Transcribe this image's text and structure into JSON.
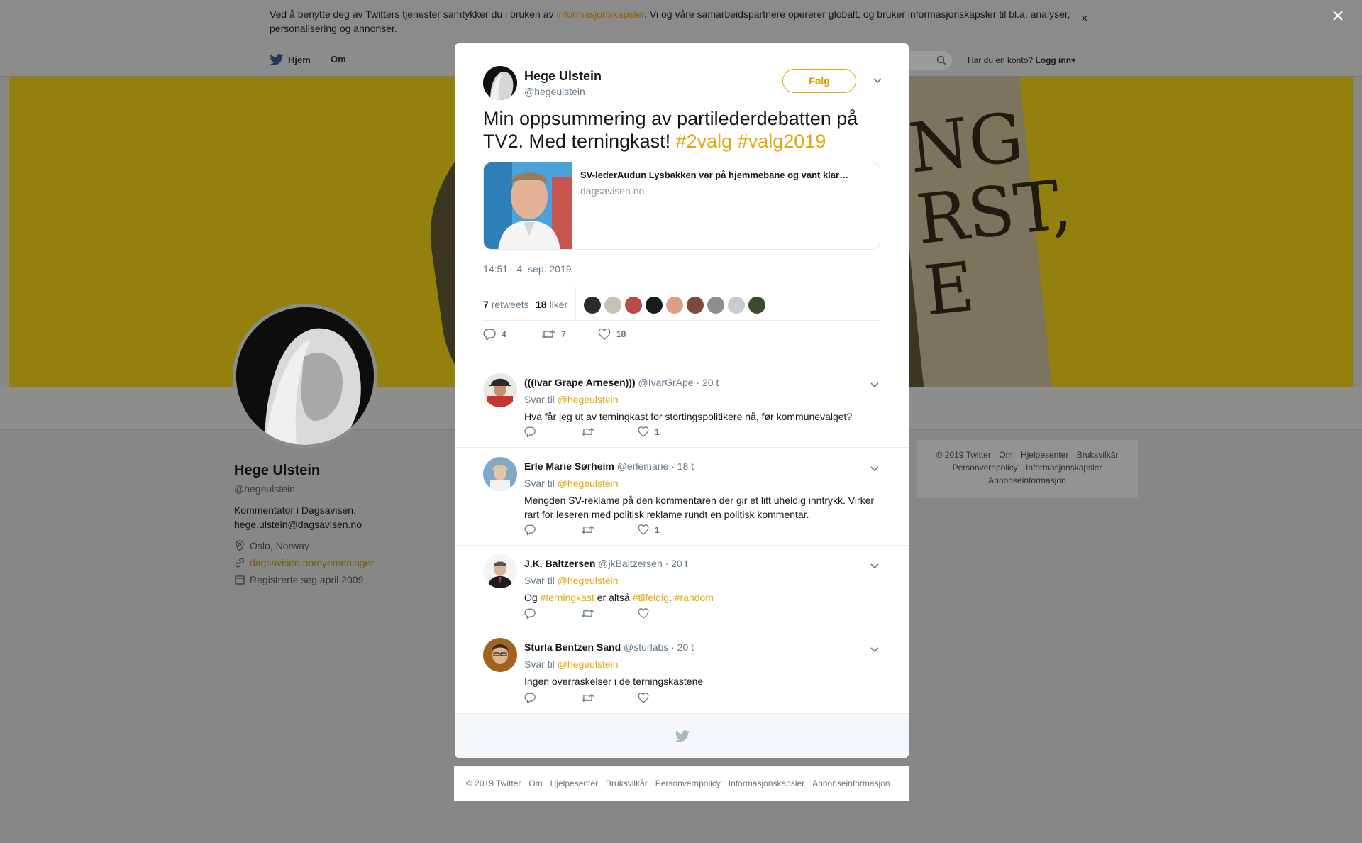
{
  "cookie_bar": {
    "text_before": "Ved å benytte deg av Twitters tjenester samtykker du i bruken av ",
    "link": "informasjonskapsler",
    "text_after": ". Vi og våre samarbeidspartnere opererer globalt, og bruker informasjonskapsler til bl.a. analyser, personalisering og annonser.",
    "close": "×"
  },
  "overlay_close": "×",
  "topnav": {
    "home": "Hjem",
    "about": "Om",
    "login_prompt": "Har du en konto?",
    "login": "Logg inn"
  },
  "banner_text": "NG\nRST,\nE",
  "profile": {
    "name": "Hege Ulstein",
    "handle": "@hegeulstein",
    "bio_line1": "Kommentator i Dagsavisen.",
    "bio_line2": "hege.ulstein@dagsavisen.no",
    "location": "Oslo, Norway",
    "link": "dagsavisen.no/nyemeninger",
    "joined": "Registrerte seg april 2009"
  },
  "right_footer": {
    "items": [
      "© 2019 Twitter",
      "Om",
      "Hjelpesenter",
      "Bruksvilkår",
      "Personvernpolicy",
      "Informasjonskapsler",
      "Annonseinformasjon"
    ]
  },
  "tweet": {
    "name": "Hege Ulstein",
    "handle": "@hegeulstein",
    "follow": "Følg",
    "text": "Min oppsummering av partilederdebatten på TV2. Med terningkast! ",
    "tag1": "#2valg",
    "tag2": "#valg2019",
    "card_title": "SV-lederAudun Lysbakken var på hjemmebane og vant klar…",
    "card_domain": "dagsavisen.no",
    "time": "14:51 - 4. sep. 2019",
    "retweets_count": "7",
    "retweets_label": "retweets",
    "likes_count": "18",
    "likes_label": "liker",
    "reply_count": "4",
    "retweet_count": "7",
    "like_count": "18"
  },
  "replies": [
    {
      "name": "(((Ivar Grape Arnesen)))",
      "handle": "@IvarGrApe",
      "time": "· 20 t",
      "to_label": "Svar til",
      "to": "@hegeulstein",
      "text": "Hva får jeg ut av terningkast for stortingspolitikere nå, før kommunevalget?",
      "likes": "1"
    },
    {
      "name": "Erle Marie Sørheim",
      "handle": "@erlemarie",
      "time": "· 18 t",
      "to_label": "Svar til",
      "to": "@hegeulstein",
      "text": "Mengden SV-reklame på den kommentaren der gir et litt uheldig inntrykk. Virker rart for leseren med politisk reklame rundt en politisk kommentar.",
      "likes": "1"
    },
    {
      "name": "J.K. Baltzersen",
      "handle": "@jkBaltzersen",
      "time": "· 20 t",
      "to_label": "Svar til",
      "to": "@hegeulstein",
      "text_og": "Og ",
      "tag1": "#terningkast",
      "text_mid": " er altså ",
      "tag2": "#tilfeldig",
      "text_dot": ". ",
      "tag3": "#random",
      "likes": ""
    },
    {
      "name": "Sturla Bentzen Sand",
      "handle": "@sturlabs",
      "time": "· 20 t",
      "to_label": "Svar til",
      "to": "@hegeulstein",
      "text": "Ingen overraskelser i de terningskastene",
      "likes": ""
    }
  ],
  "bottom_footer": {
    "items": [
      "© 2019 Twitter",
      "Om",
      "Hjelpesenter",
      "Bruksvilkår",
      "Personvernpolicy",
      "Informasjonskapsler",
      "Annonseinformasjon"
    ]
  },
  "colors": {
    "accent": "#e2a810",
    "overlay": "#878787",
    "secondary_text": "#657786"
  },
  "icons": [
    "twitter-bird-icon",
    "search-icon",
    "location-icon",
    "link-icon",
    "calendar-icon",
    "reply-icon",
    "retweet-icon",
    "heart-icon",
    "chevron-down-icon",
    "close-icon"
  ]
}
